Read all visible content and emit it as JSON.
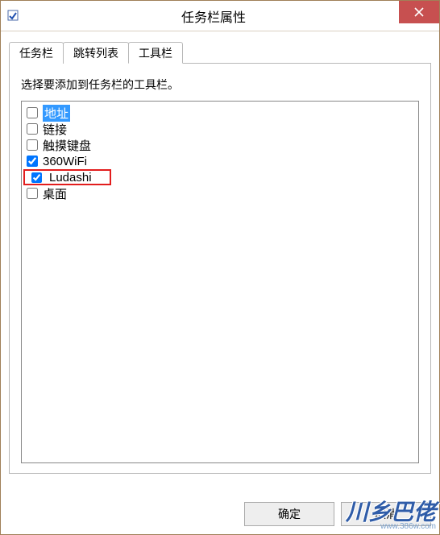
{
  "window": {
    "title": "任务栏属性"
  },
  "tabs": [
    {
      "id": "taskbar",
      "label": "任务栏",
      "active": false
    },
    {
      "id": "jumplist",
      "label": "跳转列表",
      "active": false
    },
    {
      "id": "toolbar",
      "label": "工具栏",
      "active": true
    }
  ],
  "panel": {
    "instruction": "选择要添加到任务栏的工具栏。",
    "items": [
      {
        "id": "address",
        "label": "地址",
        "checked": false,
        "selected": true,
        "highlighted": false
      },
      {
        "id": "links",
        "label": "链接",
        "checked": false,
        "selected": false,
        "highlighted": false
      },
      {
        "id": "touchkb",
        "label": "触摸键盘",
        "checked": false,
        "selected": false,
        "highlighted": false
      },
      {
        "id": "wifi",
        "label": "360WiFi",
        "checked": true,
        "selected": false,
        "highlighted": false
      },
      {
        "id": "ludashi",
        "label": "Ludashi",
        "checked": true,
        "selected": false,
        "highlighted": true
      },
      {
        "id": "desktop",
        "label": "桌面",
        "checked": false,
        "selected": false,
        "highlighted": false
      }
    ]
  },
  "buttons": {
    "ok": "确定",
    "cancel": "取消"
  },
  "watermark": {
    "logo": "川乡巴佬",
    "url": "www.386w.com"
  }
}
